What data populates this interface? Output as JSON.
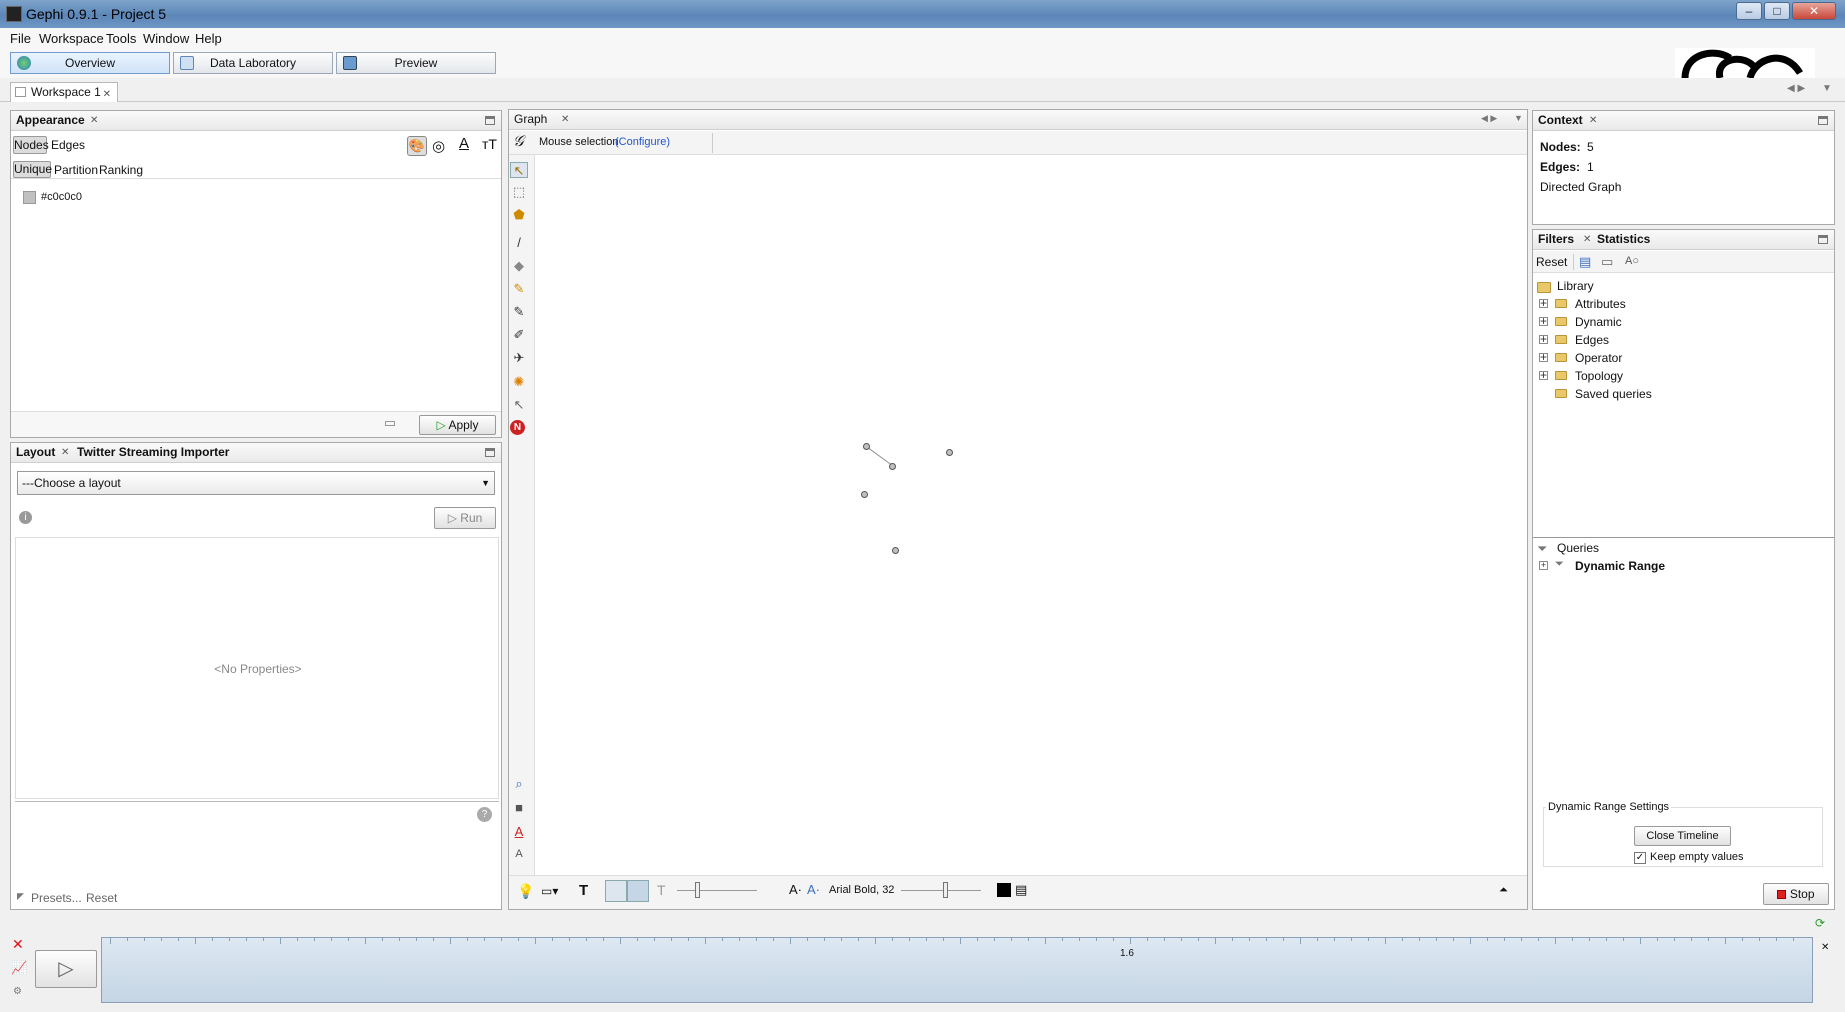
{
  "window": {
    "title": "Gephi 0.9.1 - Project 5",
    "min": "–",
    "max": "□",
    "close": "✕"
  },
  "menu": [
    "File",
    "Workspace",
    "Tools",
    "Window",
    "Help"
  ],
  "modes": {
    "overview": "Overview",
    "data_lab": "Data Laboratory",
    "preview": "Preview"
  },
  "workspace_tab": "Workspace 1",
  "appearance": {
    "tab": "Appearance",
    "target_tabs": [
      "Nodes",
      "Edges"
    ],
    "mode_tabs": [
      "Unique",
      "Partition",
      "Ranking"
    ],
    "color_value": "#c0c0c0",
    "apply": "Apply"
  },
  "layout": {
    "tabs": [
      "Layout",
      "Twitter Streaming Importer"
    ],
    "select": "---Choose a layout",
    "run": "Run",
    "no_props": "<No Properties>",
    "presets": "Presets...",
    "reset": "Reset"
  },
  "graph": {
    "tab": "Graph",
    "mode": "Mouse selection",
    "configure": "(Configure)",
    "font": "Arial Bold, 32"
  },
  "context": {
    "tab": "Context",
    "nodes_label": "Nodes:",
    "nodes": "5",
    "edges_label": "Edges:",
    "edges": "1",
    "type": "Directed Graph"
  },
  "filters": {
    "tabs": [
      "Filters",
      "Statistics"
    ],
    "reset": "Reset",
    "library": "Library",
    "items": [
      "Attributes",
      "Dynamic",
      "Edges",
      "Operator",
      "Topology",
      "Saved queries"
    ],
    "queries": "Queries",
    "query_item": "Dynamic Range",
    "settings_title": "Dynamic Range Settings",
    "close_timeline": "Close Timeline",
    "keep_empty": "Keep empty values",
    "stop": "Stop"
  },
  "timeline": {
    "tick_label": "1.6"
  }
}
